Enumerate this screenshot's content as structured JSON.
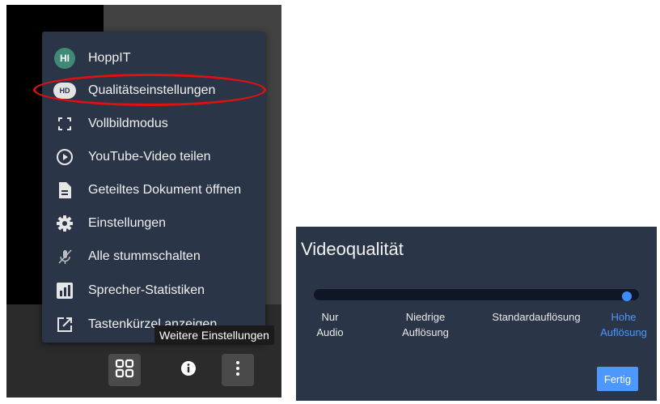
{
  "menu": {
    "items": [
      {
        "label": "HoppIT",
        "avatar_initials": "HI",
        "icon": "avatar-icon"
      },
      {
        "label": "Qualitätseinstellungen",
        "badge": "HD",
        "icon": "hd-icon"
      },
      {
        "label": "Vollbildmodus",
        "icon": "fullscreen-icon"
      },
      {
        "label": "YouTube-Video teilen",
        "icon": "play-circle-icon"
      },
      {
        "label": "Geteiltes Dokument öffnen",
        "icon": "document-icon"
      },
      {
        "label": "Einstellungen",
        "icon": "gear-icon"
      },
      {
        "label": "Alle stummschalten",
        "icon": "mic-off-icon"
      },
      {
        "label": "Sprecher-Statistiken",
        "icon": "bar-chart-icon"
      },
      {
        "label": "Tastenkürzel anzeigen",
        "icon": "external-link-icon"
      }
    ]
  },
  "tooltip": "Weitere Einstellungen",
  "toolbar": {
    "grid_icon": "tile-view-icon",
    "info_icon": "info-icon",
    "more_icon": "more-vertical-icon"
  },
  "video_quality": {
    "title": "Videoqualität",
    "options": [
      {
        "line1": "Nur",
        "line2": "Audio"
      },
      {
        "line1": "Niedrige",
        "line2": "Auflösung"
      },
      {
        "line1": "Standardauflösung",
        "line2": ""
      },
      {
        "line1": "Hohe",
        "line2": "Auflösung"
      }
    ],
    "selected_index": 3,
    "slider_level": 1.0,
    "done_label": "Fertig"
  },
  "colors": {
    "panel": "#2a3547",
    "accent": "#4c98ff",
    "highlight": "#e01010",
    "avatar": "#3f8a77"
  }
}
